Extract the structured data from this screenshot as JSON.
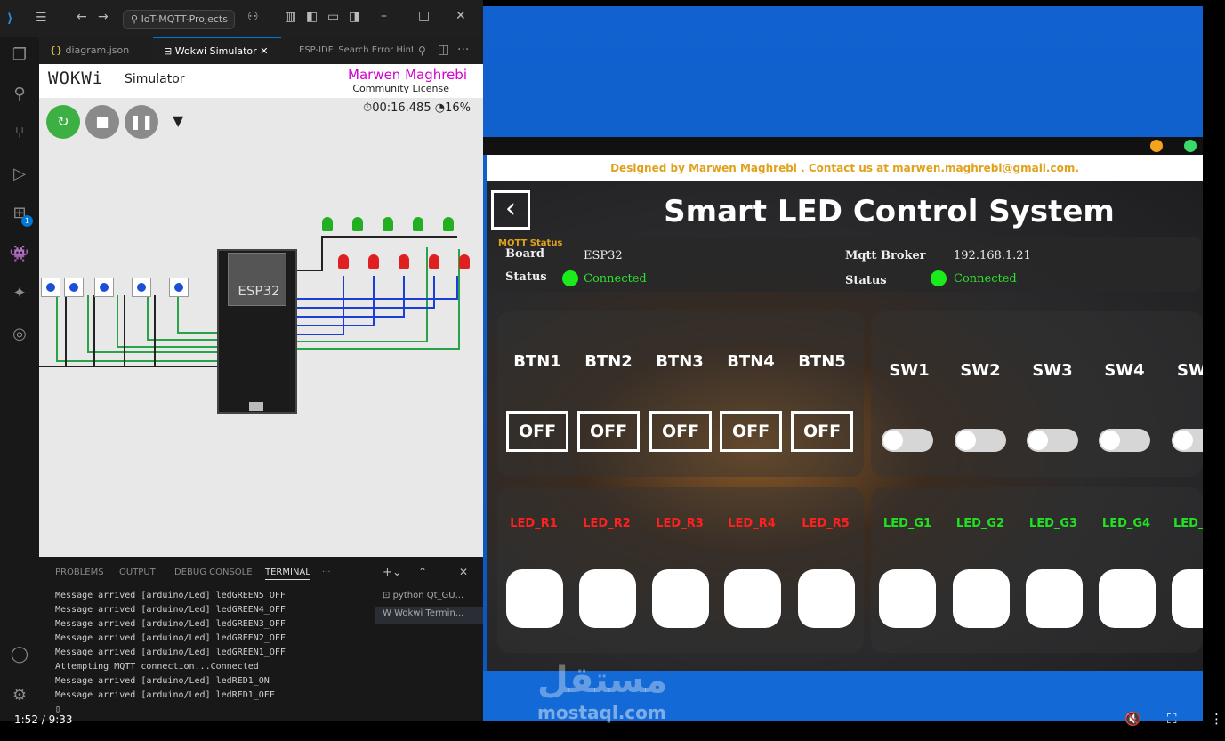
{
  "vscode": {
    "command_center": "IoT-MQTT-Projects",
    "tabs": [
      "diagram.json",
      "Wokwi Simulator",
      "ESP-IDF: Search Error Hint"
    ],
    "activity_badge": "1"
  },
  "wokwi": {
    "logo": "WOKWi",
    "subtitle": "Simulator",
    "license_name": "Marwen Maghrebi",
    "license_type": "Community License",
    "timer": "00:16.485",
    "speed": "16%",
    "chip_label": "ESP32"
  },
  "panel": {
    "tabs": [
      "PROBLEMS",
      "OUTPUT",
      "DEBUG CONSOLE",
      "TERMINAL"
    ],
    "more": "···",
    "terminal_lines": [
      "Message arrived [arduino/Led] ledGREEN5_OFF",
      "Message arrived [arduino/Led] ledGREEN4_OFF",
      "Message arrived [arduino/Led] ledGREEN3_OFF",
      "Message arrived [arduino/Led] ledGREEN2_OFF",
      "Message arrived [arduino/Led] ledGREEN1_OFF",
      "Attempting MQTT connection...Connected",
      "Message arrived [arduino/Led] ledRED1_ON",
      "Message arrived [arduino/Led] ledRED1_OFF"
    ],
    "terminal_cursor": "▯",
    "terminal_sessions": [
      "python Qt_GU...",
      "Wokwi Termin..."
    ]
  },
  "app": {
    "designed": "Designed by Marwen Maghrebi . Contact us at marwen.maghrebi@gmail.com.",
    "title": "Smart LED Control System",
    "mqtt_status": "MQTT Status",
    "board_label": "Board",
    "board_value": "ESP32",
    "status_label": "Status",
    "status_value": "Connected",
    "broker_label": "Mqtt Broker",
    "broker_value": "192.168.1.21",
    "broker_status_label": "Status",
    "broker_status_value": "Connected",
    "buttons": [
      {
        "label": "BTN1",
        "state": "OFF"
      },
      {
        "label": "BTN2",
        "state": "OFF"
      },
      {
        "label": "BTN3",
        "state": "OFF"
      },
      {
        "label": "BTN4",
        "state": "OFF"
      },
      {
        "label": "BTN5",
        "state": "OFF"
      }
    ],
    "switches": [
      "SW1",
      "SW2",
      "SW3",
      "SW4",
      "SW"
    ],
    "red_leds": [
      "LED_R1",
      "LED_R2",
      "LED_R3",
      "LED_R4",
      "LED_R5"
    ],
    "green_leds": [
      "LED_G1",
      "LED_G2",
      "LED_G3",
      "LED_G4",
      "LED_"
    ],
    "colors": {
      "red": "#ff2020",
      "green": "#22e022",
      "connected": "#1bea1b",
      "accent": "#e0a21c"
    }
  },
  "watermark": {
    "arabic": "مستقل",
    "latin": "mostaql.com"
  },
  "player": {
    "time": "1:52 / 9:33"
  }
}
